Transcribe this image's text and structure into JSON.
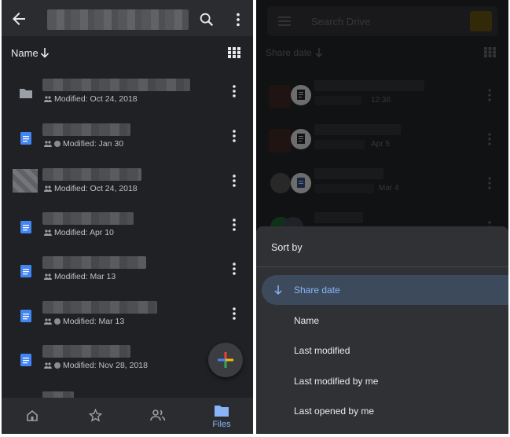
{
  "left": {
    "sort": {
      "label": "Name"
    },
    "files": [
      {
        "type": "folder",
        "modified": "Modified: Oct 24, 2018",
        "shared": false
      },
      {
        "type": "doc",
        "modified": "Modified: Jan 30",
        "shared": true
      },
      {
        "type": "image",
        "modified": "Modified: Oct 24, 2018",
        "shared": false
      },
      {
        "type": "doc",
        "modified": "Modified: Apr 10",
        "shared": false
      },
      {
        "type": "doc",
        "modified": "Modified: Mar 13",
        "shared": false
      },
      {
        "type": "doc",
        "modified": "Modified: Mar 13",
        "shared": true
      },
      {
        "type": "doc",
        "modified": "Modified: Nov 28, 2018",
        "shared": true
      }
    ],
    "nav": {
      "files_label": "Files"
    }
  },
  "right": {
    "search": {
      "placeholder": "Search Drive"
    },
    "sort": {
      "label": "Share date"
    },
    "rows": [
      {
        "meta": "12:36"
      },
      {
        "meta": "Apr 5"
      },
      {
        "meta": "Mar 4"
      }
    ],
    "sheet": {
      "title": "Sort by",
      "options": [
        {
          "label": "Share date",
          "selected": true
        },
        {
          "label": "Name",
          "selected": false
        },
        {
          "label": "Last modified",
          "selected": false
        },
        {
          "label": "Last modified by me",
          "selected": false
        },
        {
          "label": "Last opened by me",
          "selected": false
        }
      ]
    }
  },
  "colors": {
    "accent": "#8ab4f8",
    "doc_blue": "#4285f4",
    "background": "#202124"
  }
}
